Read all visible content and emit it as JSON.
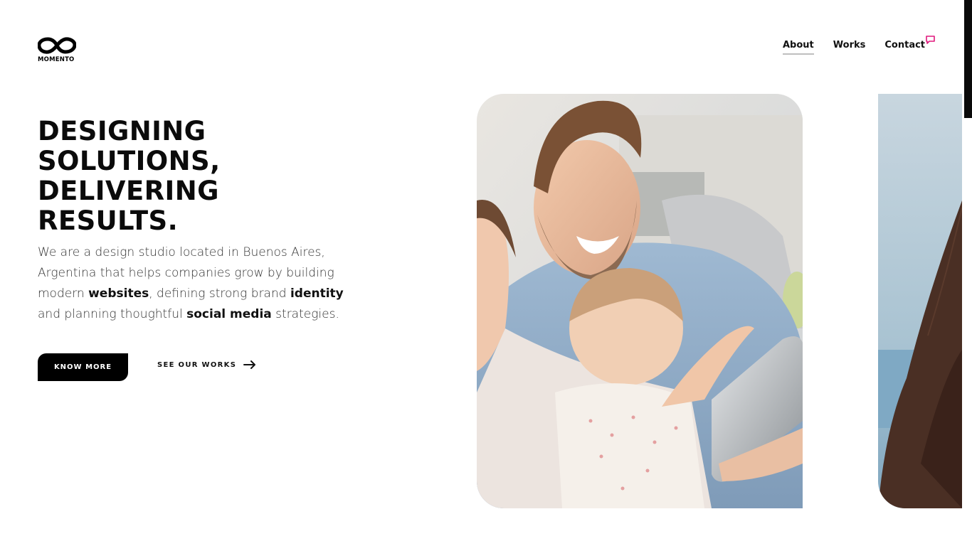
{
  "brand": {
    "name": "MOMENTO"
  },
  "nav": {
    "items": [
      {
        "label": "About"
      },
      {
        "label": "Works"
      },
      {
        "label": "Contact"
      }
    ]
  },
  "hero": {
    "headline_lines": [
      "DESIGNING",
      "SOLUTIONS,",
      "DELIVERING",
      "RESULTS."
    ],
    "intro": {
      "part1": "We are a design studio located in Buenos Aires, Argentina that helps companies grow by building modern ",
      "bold1": "websites",
      "part2": ", defining strong brand ",
      "bold2": "identity",
      "part3": " and planning thoughtful ",
      "bold3": "social media",
      "part4": " strategies."
    },
    "primary_button": "KNOW MORE",
    "secondary_link": "SEE OUR WORKS"
  },
  "colors": {
    "accent": "#e0197d",
    "button_bg": "#000000",
    "text": "#111111"
  },
  "icons": {
    "logo": "infinity-logo-icon",
    "contact": "chat-bubble-icon",
    "arrow": "arrow-right-icon"
  }
}
